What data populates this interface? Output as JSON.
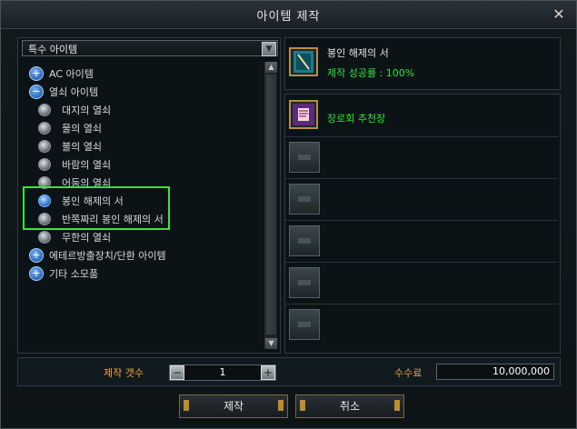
{
  "window": {
    "title": "아이템 제작",
    "close_label": "✕"
  },
  "dropdown": {
    "selected": "특수 아이템",
    "arrow": "▼"
  },
  "tree": [
    {
      "label": "AC 아이템",
      "type": "expand",
      "symbol": "+"
    },
    {
      "label": "열쇠 아이템",
      "type": "expand",
      "symbol": "−"
    },
    {
      "label": "대지의 열쇠",
      "type": "radio"
    },
    {
      "label": "물의 열쇠",
      "type": "radio"
    },
    {
      "label": "불의 열쇠",
      "type": "radio"
    },
    {
      "label": "바람의 열쇠",
      "type": "radio"
    },
    {
      "label": "어둠의 열쇠",
      "type": "radio"
    },
    {
      "label": "봉인 해제의 서",
      "type": "radio",
      "selected": true
    },
    {
      "label": "반쪽짜리 봉인 해제의 서",
      "type": "radio"
    },
    {
      "label": "무한의 열쇠",
      "type": "radio"
    },
    {
      "label": "에테르방출장치/단환 아이템",
      "type": "expand",
      "symbol": "+"
    },
    {
      "label": "기타 소모품",
      "type": "expand",
      "symbol": "+"
    }
  ],
  "scroll": {
    "up": "▲",
    "down": "▼"
  },
  "result": {
    "name": "봉인 해제의 서",
    "success_rate": "제작 성공률 : 100%"
  },
  "materials": [
    {
      "name": "장로회 추천장",
      "color": "#35e03b"
    }
  ],
  "bottom": {
    "qty_label": "제작 갯수",
    "qty_minus": "−",
    "qty_value": "1",
    "qty_plus": "+",
    "fee_label": "수수료",
    "fee_value": "10,000,000"
  },
  "buttons": {
    "craft": "제작",
    "cancel": "취소"
  },
  "colors": {
    "highlight": "#38e43a",
    "accent_orange": "#f0a43a",
    "success_green": "#35e03b"
  }
}
